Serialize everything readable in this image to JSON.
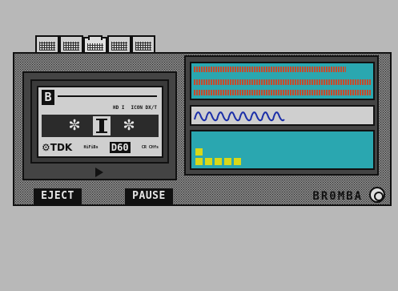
{
  "deck": {
    "cassette": {
      "side": "B",
      "tags": [
        "HD I",
        "ICON DX/T"
      ],
      "brand": "⚙TDK",
      "tape_type_left": "HiFiBs",
      "tape_length": "D60",
      "tape_type_right": "CR CHfs"
    },
    "controls": {
      "eject_label": "EJECT",
      "pause_label": "PAUSE"
    },
    "logo": "BR0MBA",
    "vu_meter": {
      "top_level": 0.86,
      "bottom_level": 1.0
    },
    "equalizer": {
      "levels": [
        2,
        1,
        1,
        1,
        1
      ]
    },
    "colors": {
      "screen": "#2aa7b0",
      "vu_bar": "#c64b2c",
      "eq_block": "#d8d81a",
      "wave": "#1c2fa8"
    }
  }
}
